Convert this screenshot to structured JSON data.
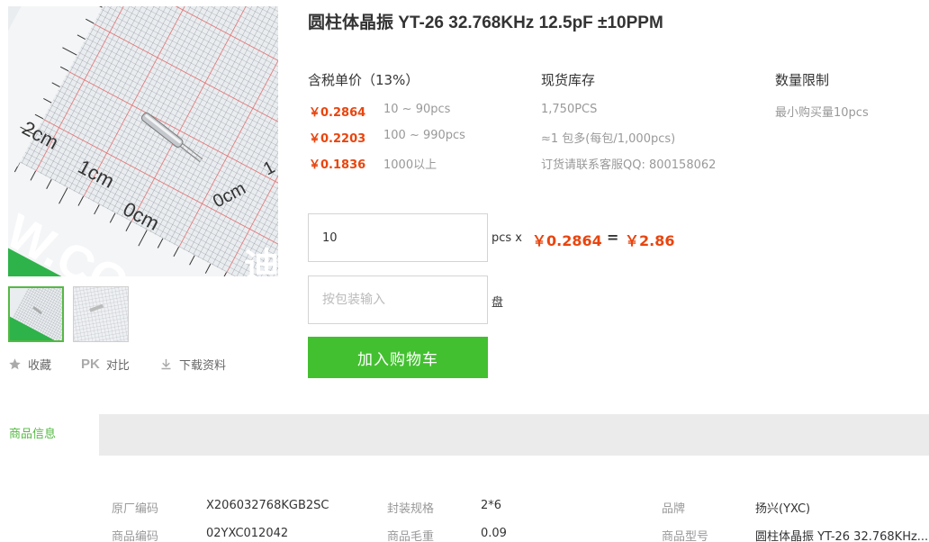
{
  "product": {
    "title": "圆柱体晶振 YT-26 32.768KHz 12.5pF ±10PPM"
  },
  "gallery": {
    "ruler_labels": [
      "2cm",
      "1cm",
      "0cm",
      "0cm",
      "1"
    ],
    "watermark": "W.CO",
    "watermark_cn": "迪",
    "thumbs": [
      {
        "name": "thumb-1",
        "active": true
      },
      {
        "name": "thumb-2",
        "active": false
      }
    ]
  },
  "actions": {
    "favorite": "收藏",
    "compare_badge": "PK",
    "compare": "对比",
    "download": "下载资料"
  },
  "pricing": {
    "price_head": "含税单价（13%）",
    "stock_head": "现货库存",
    "limit_head": "数量限制",
    "tiers": [
      {
        "price": "￥0.2864",
        "range": "10 ~ 90pcs"
      },
      {
        "price": "￥0.2203",
        "range": "100 ~ 990pcs"
      },
      {
        "price": "￥0.1836",
        "range": "1000以上"
      }
    ],
    "stock": [
      "1,750PCS",
      "≈1 包多(每包/1,000pcs)",
      "订货请联系客服QQ: 800158062"
    ],
    "limit": "最小购买量10pcs"
  },
  "order": {
    "qty_value": "10",
    "qty_unit": "pcs x",
    "unit_price": "￥0.2864",
    "equals": "=",
    "total": "￥2.86",
    "pack_placeholder": "按包装输入",
    "pack_unit": "盘",
    "add_to_cart": "加入购物车"
  },
  "tabs": {
    "info": "商品信息"
  },
  "specs": {
    "row1": [
      {
        "key": "原厂编码",
        "value": "X206032768KGB2SC"
      },
      {
        "key": "封装规格",
        "value": "2*6"
      },
      {
        "key": "品牌",
        "value": "扬兴(YXC)"
      }
    ],
    "row2": [
      {
        "key": "商品编码",
        "value": "02YXC012042"
      },
      {
        "key": "商品毛重",
        "value": "0.09"
      },
      {
        "key": "商品型号",
        "value": "圆柱体晶振 YT-26 32.768KHz..."
      }
    ]
  },
  "colors": {
    "accent_green": "#43c030",
    "price_orange": "#e9450e"
  }
}
